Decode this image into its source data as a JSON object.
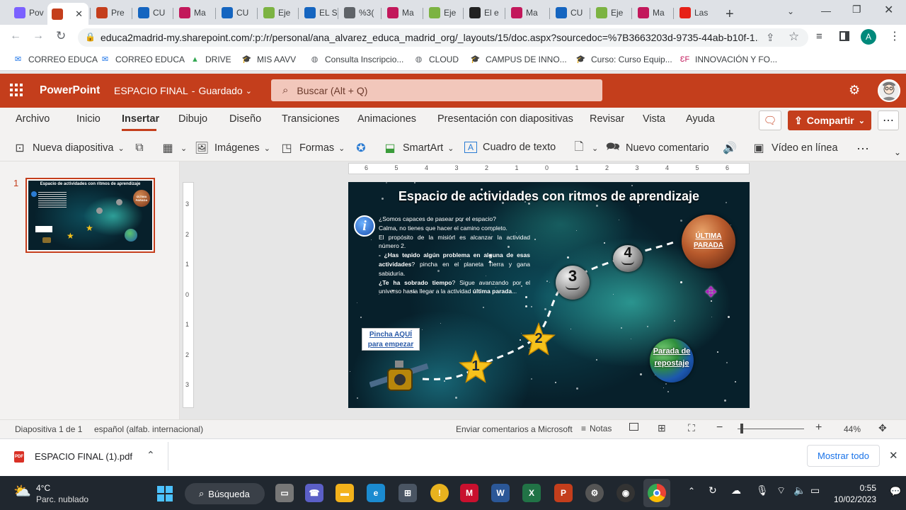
{
  "browser": {
    "tabs": [
      {
        "label": "Pov",
        "icon": "copilot-icon",
        "color": "#7b61ff"
      },
      {
        "label": "",
        "icon": "powerpoint-icon",
        "color": "#c43e1c",
        "active": true
      },
      {
        "label": "Pre",
        "icon": "powerpoint-icon",
        "color": "#c43e1c"
      },
      {
        "label": "CU",
        "icon": "clapper-icon",
        "color": "#1565c0"
      },
      {
        "label": "Ma",
        "icon": "dv-icon",
        "color": "#c2185b"
      },
      {
        "label": "CU",
        "icon": "clapper-icon",
        "color": "#1565c0"
      },
      {
        "label": "Eje",
        "icon": "grid-icon",
        "color": "#7cb342"
      },
      {
        "label": "EL S",
        "icon": "clapper-icon",
        "color": "#1565c0"
      },
      {
        "label": "%3(",
        "icon": "globe-icon",
        "color": "#5f6368"
      },
      {
        "label": "Ma",
        "icon": "dv-icon",
        "color": "#c2185b"
      },
      {
        "label": "Eje",
        "icon": "grid-icon",
        "color": "#7cb342"
      },
      {
        "label": "El e",
        "icon": "q-icon",
        "color": "#222"
      },
      {
        "label": "Ma",
        "icon": "dv-icon",
        "color": "#c2185b"
      },
      {
        "label": "CU",
        "icon": "clapper-icon",
        "color": "#1565c0"
      },
      {
        "label": "Eje",
        "icon": "grid-icon",
        "color": "#7cb342"
      },
      {
        "label": "Ma",
        "icon": "dv-icon",
        "color": "#c2185b"
      },
      {
        "label": "Las",
        "icon": "youtube-icon",
        "color": "#e62117"
      }
    ],
    "url": "educa2madrid-my.sharepoint.com/:p:/r/personal/ana_alvarez_educa_madrid_org/_layouts/15/doc.aspx?sourcedoc=%7B3663203d-9735-44ab-b10f-1...",
    "profile_initial": "A",
    "bookmarks": [
      {
        "label": "CORREO EDUCA",
        "icon": "envelope-icon"
      },
      {
        "label": "CORREO EDUCA",
        "icon": "envelope-icon"
      },
      {
        "label": "DRIVE",
        "icon": "drive-icon"
      },
      {
        "label": "MIS AAVV",
        "icon": "graduation-cap-icon"
      },
      {
        "label": "Consulta Inscripcio...",
        "icon": "globe-icon"
      },
      {
        "label": "CLOUD",
        "icon": "globe-icon"
      },
      {
        "label": "CAMPUS DE INNO...",
        "icon": "graduation-cap-icon"
      },
      {
        "label": "Curso: Curso Equip...",
        "icon": "graduation-cap-icon"
      },
      {
        "label": "INNOVACIÓN Y FO...",
        "icon": "edu-icon"
      }
    ]
  },
  "app": {
    "name": "PowerPoint",
    "doc_title": "ESPACIO FINAL",
    "save_status": "Guardado",
    "search_placeholder": "Buscar (Alt + Q)"
  },
  "ribbon": {
    "tabs": [
      "Archivo",
      "Inicio",
      "Insertar",
      "Dibujo",
      "Diseño",
      "Transiciones",
      "Animaciones",
      "Presentación con diapositivas",
      "Revisar",
      "Vista",
      "Ayuda"
    ],
    "active_tab": "Insertar",
    "share_label": "Compartir",
    "tools": {
      "new_slide": "Nueva diapositiva",
      "images": "Imágenes",
      "shapes": "Formas",
      "smartart": "SmartArt",
      "textbox": "Cuadro de texto",
      "new_comment": "Nuevo comentario",
      "online_video": "Vídeo en línea"
    }
  },
  "thumbnail": {
    "number": "1"
  },
  "ruler_h": [
    "6",
    "5",
    "4",
    "3",
    "2",
    "1",
    "0",
    "1",
    "2",
    "3",
    "4",
    "5",
    "6"
  ],
  "ruler_v": [
    "3",
    "2",
    "1",
    "0",
    "1",
    "2",
    "3"
  ],
  "slide": {
    "title": "Espacio de actividades con ritmos de aprendizaje",
    "info_lines": [
      {
        "parts": [
          {
            "t": "¿Somos capaces de pasear por el espacio?",
            "b": false
          }
        ]
      },
      {
        "parts": [
          {
            "t": "Calma, no tienes que hacer el camino completo.",
            "b": false
          }
        ]
      },
      {
        "parts": [
          {
            "t": "El propósito de la misión es alcanzar la actividad número 2.",
            "b": false
          }
        ]
      },
      {
        "parts": [
          {
            "t": "- ¿Has tenido algún problema en alguna de esas actividades",
            "b": true
          },
          {
            "t": "? pincha en el planeta Tierra y gana sabiduría.",
            "b": false
          }
        ]
      },
      {
        "parts": [
          {
            "t": "¿Te ha sobrado tiempo",
            "b": true
          },
          {
            "t": "? Sigue avanzando por el universo hasta llegar a la actividad ",
            "b": false
          },
          {
            "t": "última parada",
            "b": true
          },
          {
            "t": "...",
            "b": false
          }
        ]
      }
    ],
    "start_button": [
      "Pincha AQUÍ",
      "para empezar"
    ],
    "stars": [
      "1",
      "2"
    ],
    "asteroids": [
      "3",
      "4"
    ],
    "last_stop": [
      "ÚLTIMA",
      "PARADA"
    ],
    "earth_label": [
      "Parada de",
      "repostaje"
    ],
    "thumb_title": "Espacio de actividades con ritmos de aprendizaje",
    "thumb_last": [
      "ÚLTIMA",
      "PARADA"
    ]
  },
  "status": {
    "slide_count": "Diapositiva 1 de 1",
    "language": "español (alfab. internacional)",
    "feedback": "Enviar comentarios a Microsoft",
    "notes": "Notas",
    "zoom": "44%",
    "zoom_level": 0.44
  },
  "downloads": {
    "file": "ESPACIO FINAL (1).pdf",
    "show_all": "Mostrar todo"
  },
  "taskbar": {
    "temp": "4°C",
    "weather": "Parc. nublado",
    "search": "Búsqueda",
    "time": "0:55",
    "date": "10/02/2023"
  },
  "colors": {
    "ppt_red": "#c43e1c",
    "slide_title": "#ffffff",
    "star_gold": "#f6c21c"
  }
}
